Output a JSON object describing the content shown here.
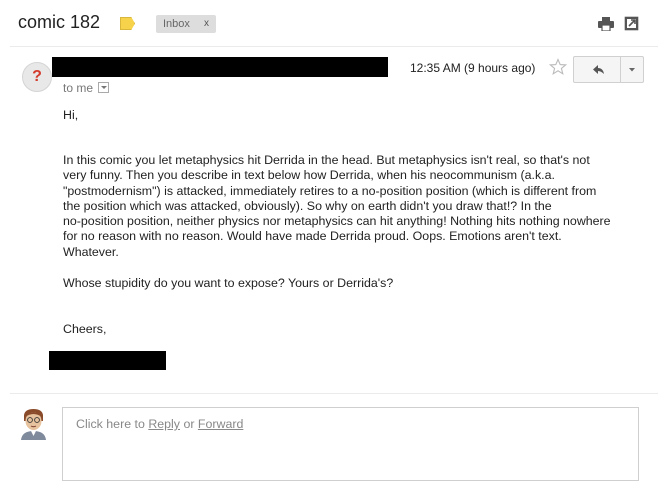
{
  "header": {
    "subject": "comic 182",
    "label_chip": "Inbox",
    "label_chip_close": "x"
  },
  "message": {
    "sender_avatar_glyph": "?",
    "timestamp": "12:35 AM (9 hours ago)",
    "recipient_line": "to me",
    "greeting": "Hi,",
    "paragraph_lines": [
      "In this comic you let metaphysics hit Derrida in the head. But metaphysics isn't real, so that's not",
      "very funny. Then you describe in text below how Derrida, when his neocommunism (a.k.a.",
      "\"postmodernism\") is attacked, immediately retires to a no-position position (which is different from",
      "the position which was attacked, obviously). So why on earth didn't you draw that!? In the",
      "no-position position, neither physics nor metaphysics can hit anything! Nothing hits nothing nowhere",
      "for no reason with no reason. Would have made Derrida proud. Oops. Emotions aren't text.",
      "Whatever."
    ],
    "question": "Whose stupidity do you want to expose? Yours or Derrida's?",
    "signoff": "Cheers,"
  },
  "reply": {
    "prompt_prefix": "Click here to ",
    "reply_link": "Reply",
    "joiner": " or ",
    "forward_link": "Forward"
  },
  "icons": {
    "label": "label-tag-icon",
    "print": "print-icon",
    "popout": "new-window-icon",
    "star": "star-icon",
    "reply": "reply-arrow-icon",
    "more": "chevron-down-icon"
  },
  "colors": {
    "label_tag": "#f6d34b",
    "sender_avatar_glyph": "#d33b2c",
    "redaction": "#000000"
  }
}
